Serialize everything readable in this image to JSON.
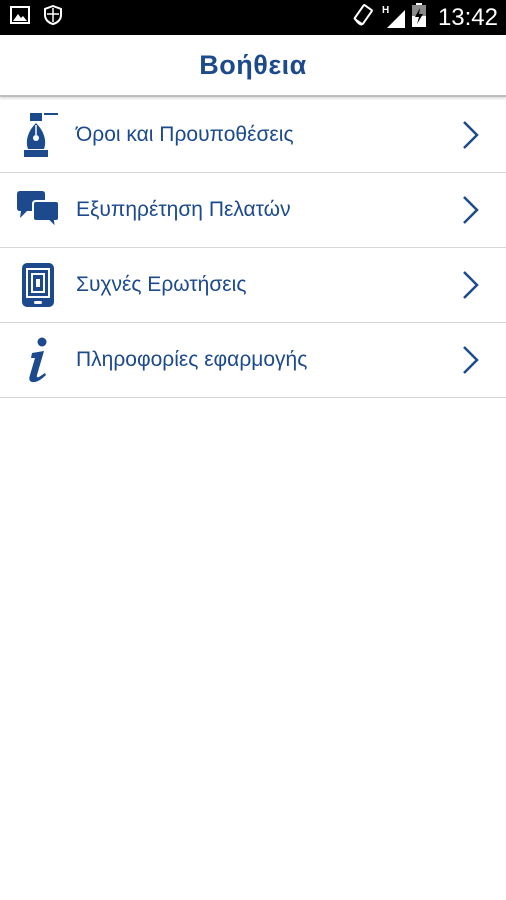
{
  "status_bar": {
    "time": "13:42",
    "network_type": "H",
    "icons": [
      "gallery-icon",
      "shield-icon",
      "rotate-icon",
      "network-type-icon",
      "signal-icon",
      "battery-charging-icon"
    ]
  },
  "header": {
    "title": "Βοήθεια"
  },
  "menu": {
    "items": [
      {
        "label": "Όροι και Προυποθέσεις",
        "icon": "fountain-pen-icon"
      },
      {
        "label": "Εξυπηρέτηση Πελατών",
        "icon": "chat-bubbles-icon"
      },
      {
        "label": "Συχνές Ερωτήσεις",
        "icon": "phone-qr-icon"
      },
      {
        "label": "Πληροφορίες εφαρμογής",
        "icon": "info-icon"
      }
    ]
  },
  "colors": {
    "accent": "#1c4a8c",
    "status_bar_bg": "#000000",
    "divider": "#d6d6d6",
    "background": "#ffffff"
  }
}
